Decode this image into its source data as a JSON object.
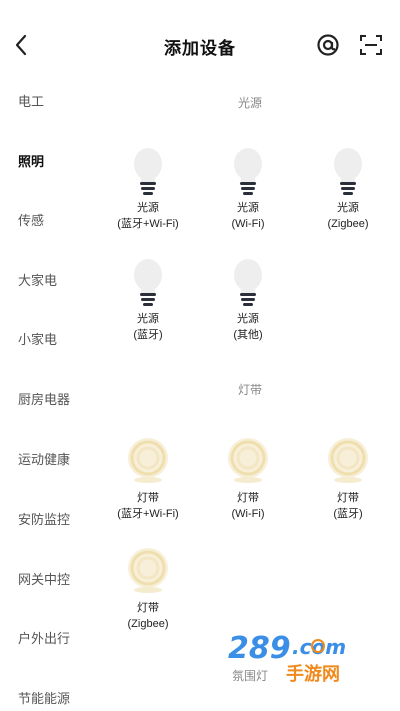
{
  "header": {
    "title": "添加设备"
  },
  "sidebar": {
    "items": [
      "电工",
      "照明",
      "传感",
      "大家电",
      "小家电",
      "厨房电器",
      "运动健康",
      "安防监控",
      "网关中控",
      "户外出行",
      "节能能源"
    ],
    "active_index": 1
  },
  "sections": {
    "light": {
      "title": "光源",
      "devices": [
        {
          "line1": "光源",
          "line2": "(蓝牙+Wi-Fi)",
          "icon": "light-bulb-icon"
        },
        {
          "line1": "光源",
          "line2": "(Wi-Fi)",
          "icon": "light-bulb-icon"
        },
        {
          "line1": "光源",
          "line2": "(Zigbee)",
          "icon": "light-bulb-icon"
        },
        {
          "line1": "光源",
          "line2": "(蓝牙)",
          "icon": "light-bulb-icon"
        },
        {
          "line1": "光源",
          "line2": "(其他)",
          "icon": "light-bulb-icon"
        }
      ]
    },
    "strip": {
      "title": "灯带",
      "devices": [
        {
          "line1": "灯带",
          "line2": "(蓝牙+Wi-Fi)",
          "icon": "light-strip-icon"
        },
        {
          "line1": "灯带",
          "line2": "(Wi-Fi)",
          "icon": "light-strip-icon"
        },
        {
          "line1": "灯带",
          "line2": "(蓝牙)",
          "icon": "light-strip-icon"
        },
        {
          "line1": "灯带",
          "line2": "(Zigbee)",
          "icon": "light-strip-icon"
        }
      ]
    },
    "ambient": {
      "title": "氛围灯"
    }
  },
  "watermark": {
    "number": "289",
    "domain": ".com",
    "text": "手游网"
  },
  "colors": {
    "bulb": "#eeeeee",
    "bulb_base": "#2a2f3a",
    "strip": "#f3e6c4",
    "watermark_blue": "#3a8ee6",
    "watermark_orange": "#f08a1c"
  }
}
